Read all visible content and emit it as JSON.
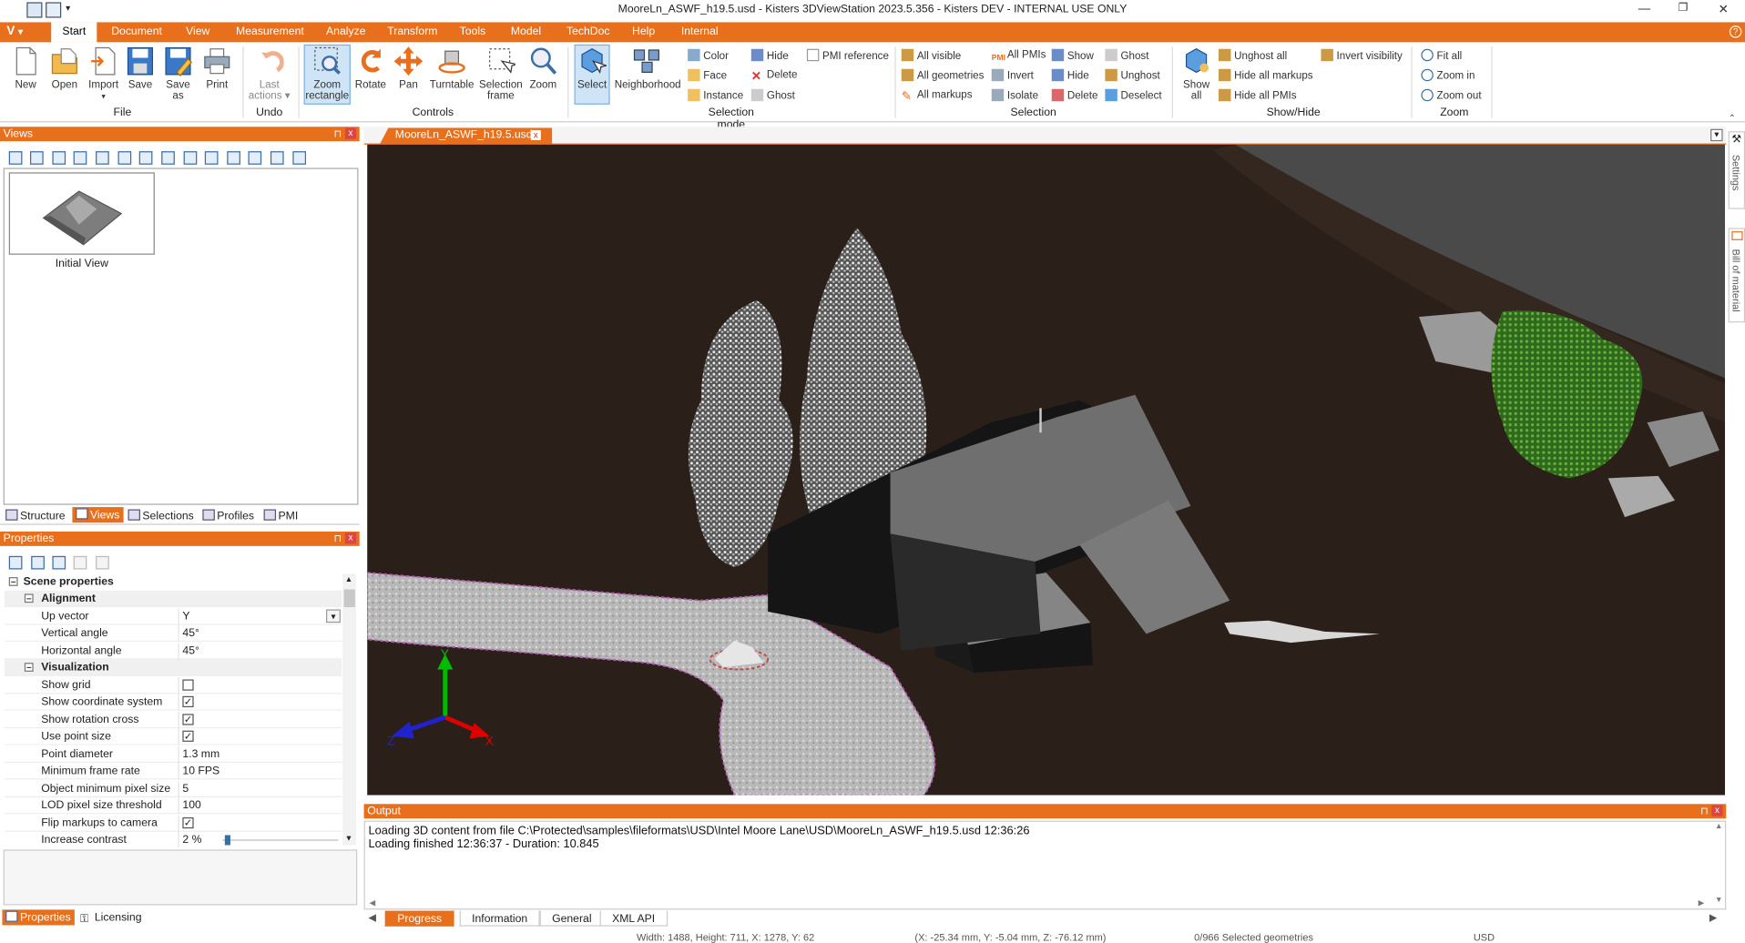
{
  "app": {
    "title": "MooreLn_ASWF_h19.5.usd - Kisters 3DViewStation 2023.5.356 - Kisters DEV - INTERNAL USE ONLY",
    "logo": "V"
  },
  "tabs": [
    "Start",
    "Document",
    "View",
    "Measurement",
    "Analyze",
    "Transform",
    "Tools",
    "Model",
    "TechDoc",
    "Help",
    "Internal"
  ],
  "ribbon": {
    "file": {
      "group": "File",
      "new": "New",
      "open": "Open",
      "import": "Import",
      "save": "Save",
      "save_as_1": "Save",
      "save_as_2": "as",
      "print": "Print"
    },
    "undo": {
      "group": "Undo",
      "last_1": "Last",
      "last_2": "actions ▾"
    },
    "controls": {
      "group": "Controls",
      "zoom_rect_1": "Zoom",
      "zoom_rect_2": "rectangle",
      "rotate": "Rotate",
      "pan": "Pan",
      "turntable": "Turntable",
      "sel_frame_1": "Selection",
      "sel_frame_2": "frame",
      "zoom": "Zoom"
    },
    "selmode": {
      "group": "Selection mode",
      "select": "Select",
      "neighborhood": "Neighborhood",
      "color": "Color",
      "face": "Face",
      "instance": "Instance",
      "hide": "Hide",
      "delete": "Delete",
      "ghost": "Ghost",
      "pmi_ref": "PMI reference"
    },
    "selection": {
      "group": "Selection",
      "all_visible": "All visible",
      "all_geometries": "All geometries",
      "all_markups": "All markups",
      "all_pmis": "All PMIs",
      "invert": "Invert",
      "isolate": "Isolate",
      "show": "Show",
      "hide": "Hide",
      "delete": "Delete",
      "ghost": "Ghost",
      "unghost": "Unghost",
      "deselect": "Deselect"
    },
    "showhide": {
      "group": "Show/Hide",
      "show_all_1": "Show",
      "show_all_2": "all",
      "unghost_all": "Unghost all",
      "hide_all_markups": "Hide all markups",
      "hide_all_pmis": "Hide all PMIs",
      "invert_visibility": "Invert visibility"
    },
    "zoomgrp": {
      "group": "Zoom",
      "fit_all": "Fit all",
      "zoom_in": "Zoom in",
      "zoom_out": "Zoom out"
    }
  },
  "views_panel": {
    "title": "Views",
    "thumb_label": "Initial View",
    "pin": "⊓",
    "close": "x"
  },
  "left_tabs": [
    "Structure",
    "Views",
    "Selections",
    "Profiles",
    "PMI"
  ],
  "properties": {
    "title": "Properties",
    "scene": "Scene properties",
    "alignment": "Alignment",
    "visualization": "Visualization",
    "rows": [
      {
        "key": "Up vector",
        "value": "Y"
      },
      {
        "key": "Vertical angle",
        "value": "45°"
      },
      {
        "key": "Horizontal angle",
        "value": "45°"
      }
    ],
    "vis_rows": [
      {
        "key": "Show grid",
        "checked": false
      },
      {
        "key": "Show coordinate system",
        "checked": true
      },
      {
        "key": "Show rotation cross",
        "checked": true
      },
      {
        "key": "Use point size",
        "checked": true
      },
      {
        "key": "Point diameter",
        "value": "1.3 mm"
      },
      {
        "key": "Minimum frame rate",
        "value": "10 FPS"
      },
      {
        "key": "Object minimum pixel size",
        "value": "5"
      },
      {
        "key": "LOD pixel size threshold",
        "value": "100"
      },
      {
        "key": "Flip markups to camera",
        "checked": true
      },
      {
        "key": "Increase contrast",
        "value": "2 %",
        "slider": 0.02
      }
    ]
  },
  "bottom_left_tabs": [
    "Properties",
    "Licensing"
  ],
  "document_tab": "MooreLn_ASWF_h19.5.usd",
  "right_side_tabs": [
    "Settings",
    "Bill of material"
  ],
  "axes": {
    "x": "X",
    "y": "Y",
    "z": "Z"
  },
  "output": {
    "title": "Output",
    "lines": [
      "Loading 3D content from file C:\\Protected\\samples\\fileformats\\USD\\Intel Moore Lane\\USD\\MooreLn_ASWF_h19.5.usd 12:36:26",
      "Loading finished 12:36:37 - Duration: 10.845"
    ],
    "tabs": [
      "Progress",
      "Information",
      "General",
      "XML API"
    ]
  },
  "status": {
    "dims": "Width: 1488, Height: 711, X: 1278, Y: 62",
    "coords": "(X: -25.34 mm, Y: -5.04 mm, Z: -76.12 mm)",
    "selected": "0/966 Selected geometries",
    "format": "USD"
  }
}
